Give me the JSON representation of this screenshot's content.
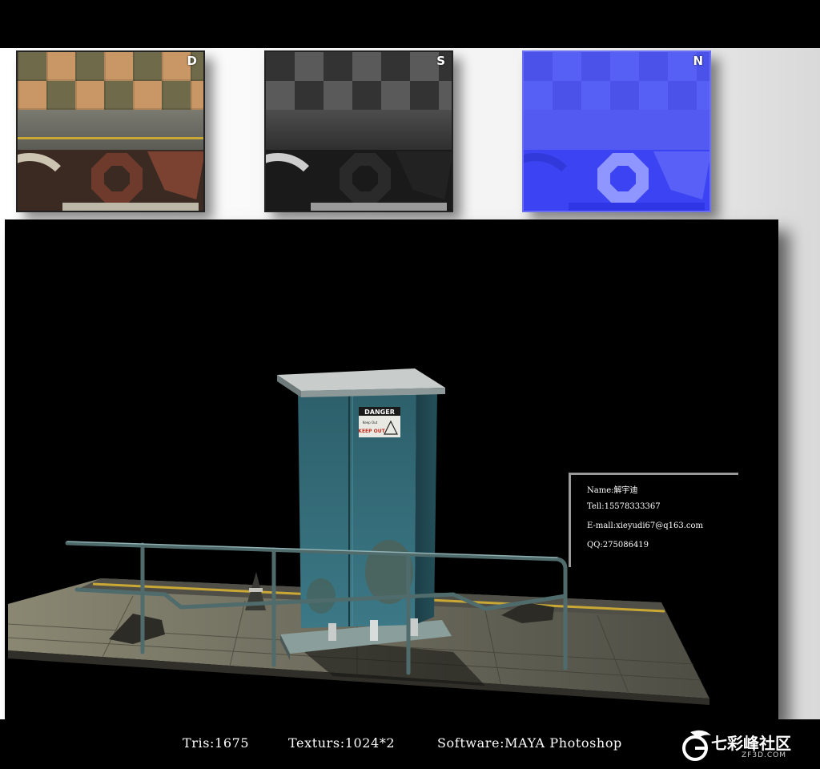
{
  "textures": [
    {
      "label": "D"
    },
    {
      "label": "S"
    },
    {
      "label": "N"
    }
  ],
  "viewport": {
    "box_sign": {
      "title": "DANGER",
      "small_text": "Keep Out",
      "action": "KEEP OUT"
    }
  },
  "info": {
    "name": "Name:解宇迪",
    "tel": "Tell:15578333367",
    "email": "E-mall:xieyudi67@q163.com",
    "qq": "QQ:275086419"
  },
  "stats": {
    "tris": "Tris:1675",
    "textures": "Texturs:1024*2",
    "software": "Software:MAYA Photoshop"
  },
  "logo": {
    "text_cn": "七彩峰社区",
    "text_en": "ZF3D.COM"
  },
  "colors": {
    "box": "#2f6670",
    "floor": "#6d6b5e",
    "normal_map": "#4b52f0"
  }
}
